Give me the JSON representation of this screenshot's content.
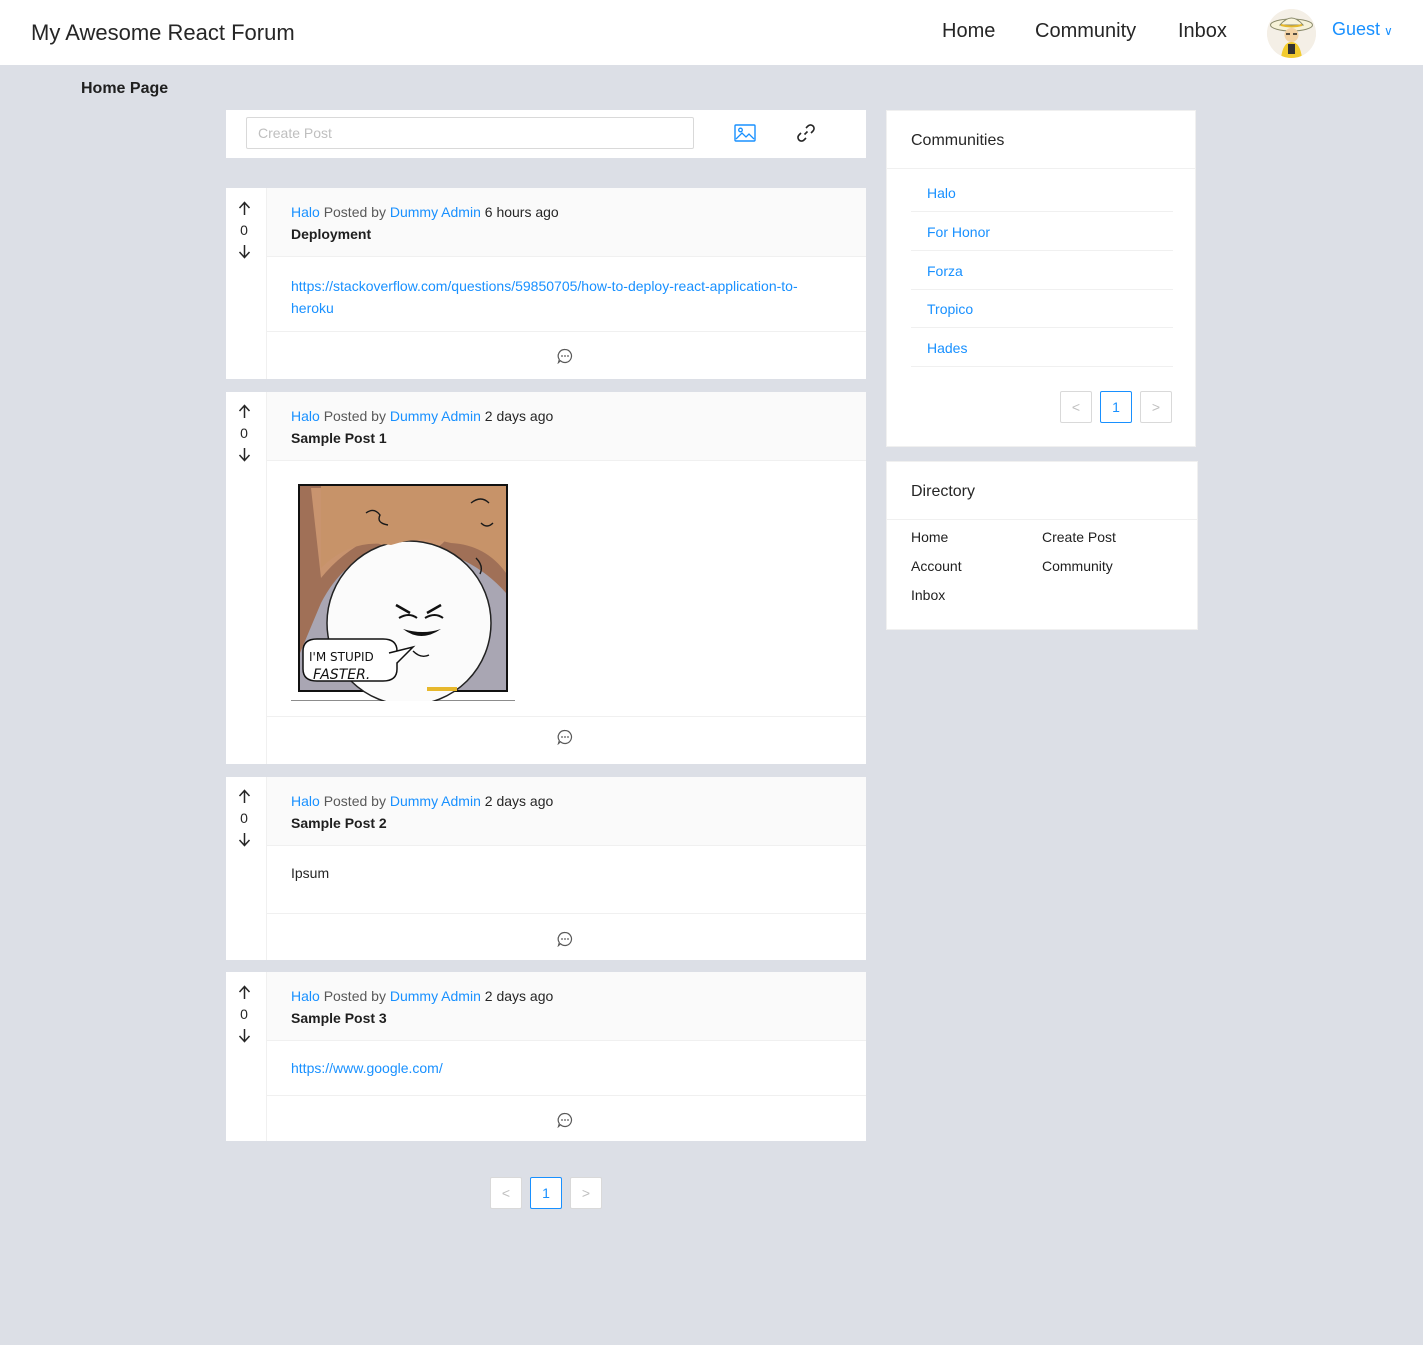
{
  "header": {
    "brand": "My Awesome React Forum",
    "nav": [
      "Home",
      "Community",
      "Inbox"
    ],
    "user_label": "Guest",
    "user_chevron": "∨"
  },
  "page": {
    "title": "Home Page"
  },
  "create_post": {
    "placeholder": "Create Post",
    "image_icon": "image-icon",
    "link_icon": "link-icon"
  },
  "posts": [
    {
      "community": "Halo",
      "posted_by": "Posted by",
      "author": "Dummy Admin",
      "time": "6 hours ago",
      "title": "Deployment",
      "score": "0",
      "link_line1": "https://stackoverflow.com/questions/59850705/how-to-deploy-react-application-to-",
      "link_line2": "heroku"
    },
    {
      "community": "Halo",
      "posted_by": "Posted by",
      "author": "Dummy Admin",
      "time": "2 days ago",
      "title": "Sample Post 1",
      "score": "0",
      "image_text_1": "I'M STUPID",
      "image_text_2": "FASTER."
    },
    {
      "community": "Halo",
      "posted_by": "Posted by",
      "author": "Dummy Admin",
      "time": "2 days ago",
      "title": "Sample Post 2",
      "score": "0",
      "body": "Ipsum"
    },
    {
      "community": "Halo",
      "posted_by": "Posted by",
      "author": "Dummy Admin",
      "time": "2 days ago",
      "title": "Sample Post 3",
      "score": "0",
      "link": "https://www.google.com/"
    }
  ],
  "pagination": {
    "prev": "<",
    "page": "1",
    "next": ">"
  },
  "communities": {
    "title": "Communities",
    "items": [
      "Halo",
      "For Honor",
      "Forza",
      "Tropico",
      "Hades"
    ],
    "pagination": {
      "prev": "<",
      "page": "1",
      "next": ">"
    }
  },
  "directory": {
    "title": "Directory",
    "items": [
      "Home",
      "Create Post",
      "Account",
      "Community",
      "Inbox"
    ]
  },
  "colors": {
    "accent": "#1890ff",
    "background": "#dcdfe6"
  }
}
